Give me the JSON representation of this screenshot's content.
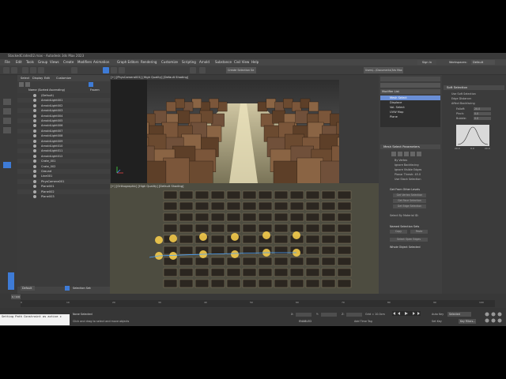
{
  "title_bar": {
    "text": "StackedCrates02.max - Autodesk 3ds Max 2023"
  },
  "menu": [
    "File",
    "Edit",
    "Tools",
    "Group",
    "Views",
    "Create",
    "Modifiers",
    "Animation",
    "Graph Editors",
    "Rendering",
    "Customize",
    "Scripting",
    "Arnold",
    "Substance",
    "Civil View",
    "Help"
  ],
  "top_right": {
    "user_label": "Sign In",
    "workspace_label": "Workspaces:",
    "workspace_value": "Default"
  },
  "toolbar": {
    "selection_set_placeholder": "Create Selection Se",
    "path_text": "Users\\...\\Documents\\3ds Max 2023"
  },
  "scene_explorer": {
    "tabs": [
      "Select",
      "Display",
      "Edit",
      "Customize"
    ],
    "column_name": "Name (Sorted Ascending)",
    "column_frozen": "Frozen",
    "items": [
      "(Default)",
      "ArnoldLight001",
      "ArnoldLight002",
      "ArnoldLight003",
      "ArnoldLight004",
      "ArnoldLight005",
      "ArnoldLight006",
      "ArnoldLight007",
      "ArnoldLight008",
      "ArnoldLight009",
      "ArnoldLight010",
      "ArnoldLight011",
      "ArnoldLight012",
      "Crate_001",
      "Crate_002",
      "Ground",
      "Line001",
      "PhysCamera001",
      "Plane001",
      "Plane002",
      "Plane003"
    ]
  },
  "viewports": {
    "top_label": "[+] [PhysCamera001] [High Quality] [Default Shading]",
    "bottom_label": "[+] [Orthographic] [High Quality] [Default Shading]"
  },
  "command_panel": {
    "object_name": "Plane001",
    "modifier_list_label": "Modifier List",
    "stack": [
      "Mesh Select",
      "Displace",
      "Vol. Select",
      "UVW Map",
      "Plane"
    ],
    "rollout_title": "Mesh Select Parameters",
    "options": [
      "By Vertex",
      "Ignore Backfacing",
      "Ignore Visible Edges",
      "Planar Thresh: 45.0",
      "Use Stack Selection"
    ],
    "get_from_other_levels": "Get From Other Levels",
    "buttons": [
      "Get Vertex Selection",
      "Get Face Selection",
      "Get Edge Selection"
    ],
    "select_by_material": "Select By Material ID:",
    "named_selection_sets": "Named Selection Sets",
    "copy_paste": [
      "Copy",
      "Paste"
    ],
    "select_open_edges": "Select Open Edges",
    "whole_object_selected": "Whole Object Selected"
  },
  "soft_selection": {
    "title": "Soft Selection",
    "options": [
      "Use Soft Selection",
      "Edge Distance:",
      "Affect Backfacing"
    ],
    "falloff_label": "Falloff:",
    "falloff_value": "20.0",
    "pinch_label": "Pinch:",
    "pinch_value": "0.0",
    "bubble_label": "Bubble:",
    "bubble_value": "0.0",
    "curve_ticks": [
      "20.0",
      "0.0",
      "20.0"
    ]
  },
  "timeline": {
    "frame_readout": "0 / 100",
    "ticks": [
      "0",
      "10",
      "20",
      "30",
      "40",
      "50",
      "60",
      "70",
      "80",
      "90",
      "100"
    ]
  },
  "status": {
    "maxscript": "Setting Path Constraint as active c",
    "selection": "None Selected",
    "prompt": "Click and drag to select and move objects",
    "x_label": "X:",
    "y_label": "Y:",
    "z_label": "Z:",
    "grid": "Grid = 10.0cm",
    "add_time_tag": "Add Time Tag",
    "autokey": "Auto Key",
    "autokey_value": "Selected",
    "setkey": "Set Key",
    "key_filters": "Key Filters...",
    "layer_default": "Default",
    "selection_sets": "Selection Set:",
    "enabled": "ENABLED"
  },
  "colors": {
    "accent": "#3e7bd6",
    "selected_stack": "#6a8fd6",
    "light": "#ffd34d"
  }
}
